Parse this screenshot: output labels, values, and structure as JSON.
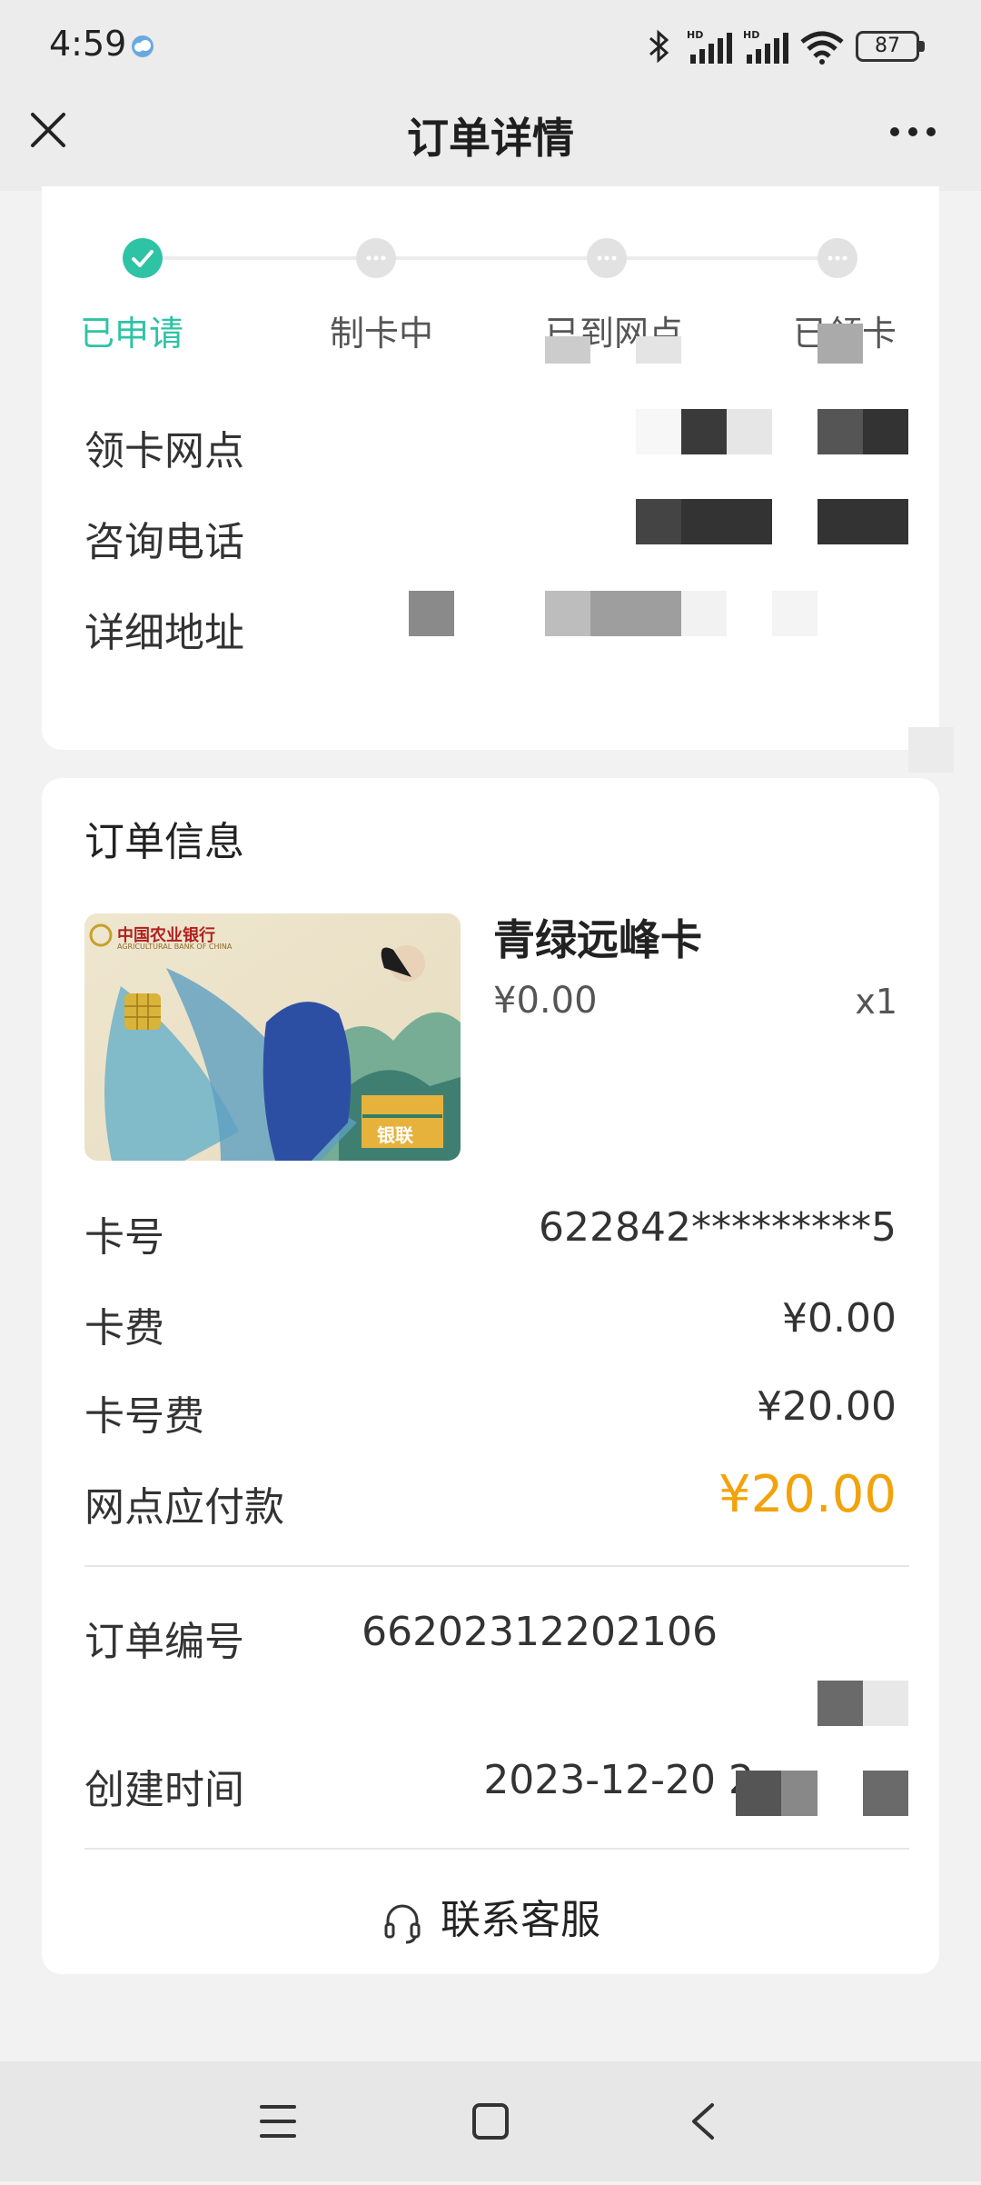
{
  "status_bar": {
    "time": "4:59",
    "battery": "87",
    "icons": [
      "bluetooth-icon",
      "hd-signal-icon",
      "hd-signal-icon",
      "wifi-icon",
      "battery-icon"
    ]
  },
  "header": {
    "title": "订单详情"
  },
  "progress": {
    "steps": [
      {
        "label": "已申请",
        "state": "done"
      },
      {
        "label": "制卡中",
        "state": "pending"
      },
      {
        "label": "已到网点",
        "state": "pending"
      },
      {
        "label": "已领卡",
        "state": "pending"
      }
    ],
    "accent_color": "#2ec3a5"
  },
  "branch_info": {
    "pickup_branch_label": "领卡网点",
    "phone_label": "咨询电话",
    "address_label": "详细地址"
  },
  "order": {
    "section_title": "订单信息",
    "product_name": "青绿远峰卡",
    "product_price": "¥0.00",
    "quantity": "x1",
    "card_brand": "中国农业银行",
    "card_brand_en": "AGRICULTURAL BANK OF CHINA",
    "card_network": "银联",
    "rows": {
      "card_number_label": "卡号",
      "card_number_value": "622842*********5",
      "card_fee_label": "卡费",
      "card_fee_value": "¥0.00",
      "number_fee_label": "卡号费",
      "number_fee_value": "¥20.00",
      "payable_label": "网点应付款",
      "payable_value": "¥20.00",
      "order_no_label": "订单编号",
      "order_no_value": "66202312202106",
      "created_label": "创建时间",
      "created_value": "2023-12-20 2"
    },
    "total_color": "#f2a20a"
  },
  "contact": {
    "label": "联系客服"
  }
}
